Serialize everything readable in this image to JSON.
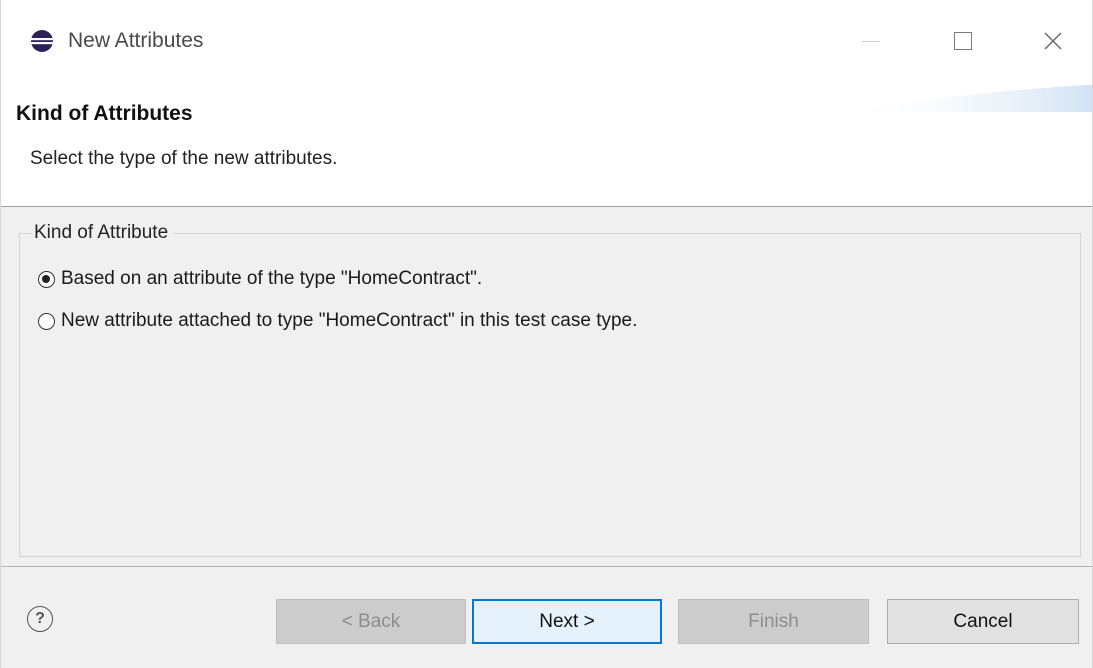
{
  "window": {
    "title": "New Attributes"
  },
  "banner": {
    "title": "Kind of Attributes",
    "description": "Select the type of the new attributes."
  },
  "group": {
    "label": "Kind of Attribute",
    "options": [
      {
        "label": "Based on an attribute of the type \"HomeContract\".",
        "checked": true
      },
      {
        "label": "New attribute attached to type \"HomeContract\" in this test case type.",
        "checked": false
      }
    ]
  },
  "buttons": {
    "help": "?",
    "back": "< Back",
    "next": "Next >",
    "finish": "Finish",
    "cancel": "Cancel"
  },
  "colors": {
    "accent": "#0078d7",
    "background": "#f0f0f0"
  },
  "icons": {
    "app": "eclipse-icon",
    "minimize": "minimize-icon",
    "maximize": "maximize-icon",
    "close": "close-icon",
    "help": "help-icon"
  }
}
